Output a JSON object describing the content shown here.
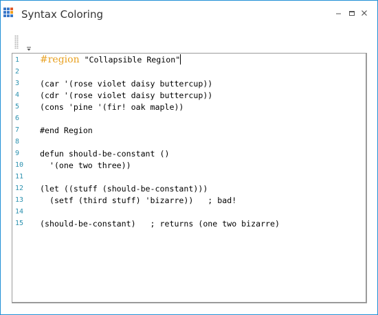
{
  "window": {
    "title": "Syntax Coloring",
    "border_color": "#1e8fd6",
    "icons": {
      "app": "grid-app-icon",
      "minimize": "minimize-icon",
      "maximize": "maximize-icon",
      "close": "close-icon"
    }
  },
  "toolbar": {
    "grip": "grip-handle",
    "overflow": "overflow-chevron-icon"
  },
  "editor": {
    "colors": {
      "line_number": "#2b91af",
      "region_keyword": "#e8a020",
      "text": "#000000"
    },
    "lines": [
      {
        "num": "1",
        "region_kw": "#region",
        "region_str": "\"Collapsible Region\""
      },
      {
        "num": "2",
        "text": ""
      },
      {
        "num": "3",
        "text": "(car '(rose violet daisy buttercup))"
      },
      {
        "num": "4",
        "text": "(cdr '(rose violet daisy buttercup))"
      },
      {
        "num": "5",
        "text": "(cons 'pine '(fir! oak maple))"
      },
      {
        "num": "6",
        "text": ""
      },
      {
        "num": "7",
        "text": "#end Region"
      },
      {
        "num": "8",
        "text": ""
      },
      {
        "num": "9",
        "text": "defun should-be-constant ()"
      },
      {
        "num": "10",
        "text": "  '(one two three))"
      },
      {
        "num": "11",
        "text": ""
      },
      {
        "num": "12",
        "text": "(let ((stuff (should-be-constant)))"
      },
      {
        "num": "13",
        "text": "  (setf (third stuff) 'bizarre))   ; bad!"
      },
      {
        "num": "14",
        "text": ""
      },
      {
        "num": "15",
        "text": "(should-be-constant)   ; returns (one two bizarre)"
      }
    ]
  }
}
